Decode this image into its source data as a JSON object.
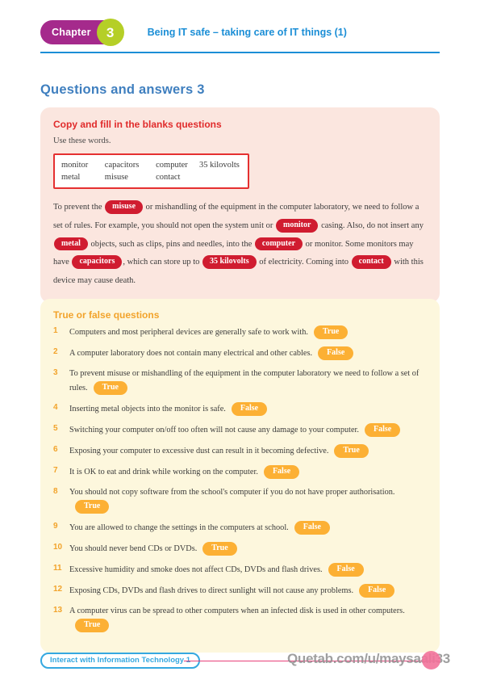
{
  "header": {
    "chapter_label": "Chapter",
    "chapter_number": "3",
    "chapter_title": "Being IT safe – taking care of IT things (1)"
  },
  "page_title": "Questions and answers 3",
  "cloze_section": {
    "heading": "Copy and fill in the blanks questions",
    "instruction": "Use these words.",
    "wordbank": {
      "row1": [
        "monitor",
        "capacitors",
        "computer",
        "35 kilovolts"
      ],
      "row2": [
        "metal",
        "misuse",
        "contact",
        ""
      ]
    },
    "paragraph": [
      {
        "type": "text",
        "value": "To prevent the "
      },
      {
        "type": "blank",
        "value": "misuse"
      },
      {
        "type": "text",
        "value": " or mishandling of the equipment in the computer laboratory, we need to follow a set of rules. For example, you should not open the system unit or "
      },
      {
        "type": "blank",
        "value": "monitor"
      },
      {
        "type": "text",
        "value": " casing. Also, do not insert any "
      },
      {
        "type": "blank",
        "value": "metal"
      },
      {
        "type": "text",
        "value": " objects, such as clips, pins and needles, into the "
      },
      {
        "type": "blank",
        "value": "computer"
      },
      {
        "type": "text",
        "value": " or monitor. Some monitors may have "
      },
      {
        "type": "blank",
        "value": "capacitors"
      },
      {
        "type": "text",
        "value": ", which can store up to "
      },
      {
        "type": "blank",
        "value": "35 kilovolts"
      },
      {
        "type": "text",
        "value": " of electricity. Coming into "
      },
      {
        "type": "blank",
        "value": "contact"
      },
      {
        "type": "text",
        "value": " with this device may cause death."
      }
    ]
  },
  "truefalse_section": {
    "heading": "True or false questions",
    "items": [
      {
        "num": "1",
        "text": "Computers and most peripheral devices are generally safe to work with.",
        "answer": "True"
      },
      {
        "num": "2",
        "text": "A computer laboratory does not contain many electrical and other cables.",
        "answer": "False"
      },
      {
        "num": "3",
        "text": "To prevent misuse or mishandling of the equipment in the computer laboratory we need to follow a set of rules.",
        "answer": "True"
      },
      {
        "num": "4",
        "text": "Inserting metal objects into the monitor is safe.",
        "answer": "False"
      },
      {
        "num": "5",
        "text": "Switching your computer on/off too often will not cause any damage to your computer.",
        "answer": "False"
      },
      {
        "num": "6",
        "text": "Exposing your computer to excessive dust can result in it becoming defective.",
        "answer": "True"
      },
      {
        "num": "7",
        "text": "It is OK to eat and drink while working on the computer.",
        "answer": "False"
      },
      {
        "num": "8",
        "text": "You should not copy software from the school's computer if you do not have proper authorisation.",
        "answer": "True"
      },
      {
        "num": "9",
        "text": "You are allowed to change the settings in the computers at school.",
        "answer": "False"
      },
      {
        "num": "10",
        "text": "You should never bend CDs or DVDs.",
        "answer": "True"
      },
      {
        "num": "11",
        "text": "Excessive humidity and smoke does not affect CDs, DVDs and flash drives.",
        "answer": "False"
      },
      {
        "num": "12",
        "text": "Exposing CDs, DVDs and flash drives to direct sunlight will not cause any problems.",
        "answer": "False"
      },
      {
        "num": "13",
        "text": "A computer virus can be spread to other computers when an infected disk is used in other computers.",
        "answer": "True"
      }
    ]
  },
  "footer": {
    "book_title": "Interact with Information Technology 1",
    "watermark": "Quetab.com/u/maysaali33"
  },
  "colors": {
    "chapter_pill": "#a52a8c",
    "chapter_circle": "#b5cf27",
    "header_blue": "#1b8ed6",
    "title_blue": "#3f7fbf",
    "cloze_panel": "#fbe6df",
    "cloze_heading": "#e02b2b",
    "blank_pill": "#d01c30",
    "wordbank_border": "#e53030",
    "tf_panel": "#fdf7dd",
    "tf_heading": "#f2a32b",
    "answer_pill": "#fcb034",
    "footer_blue": "#35a8e0",
    "footer_rule": "#e8407a",
    "watermark_badge": "#f2729a"
  }
}
